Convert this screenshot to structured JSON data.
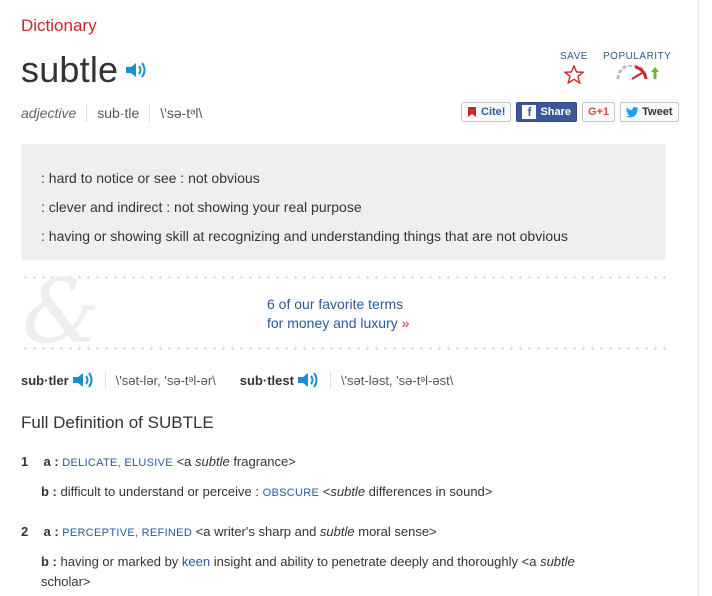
{
  "header": {
    "section_label": "Dictionary",
    "headword": "subtle",
    "part_of_speech": "adjective",
    "syllables": "sub·tle",
    "pronunciation": "\\'sə-tᵊl\\"
  },
  "actions": {
    "save_label": "SAVE",
    "popularity_label": "POPULARITY"
  },
  "share": {
    "cite": "Cite!",
    "facebook": "Share",
    "gplus": "G+1",
    "tweet": "Tweet"
  },
  "short_definitions": [
    ": hard to notice or see : not obvious",
    ": clever and indirect : not showing your real purpose",
    ": having or showing skill at recognizing and understanding things that are not obvious"
  ],
  "promo": {
    "line1": "6 of our favorite terms",
    "line2": "for money and luxury",
    "arrow": "»"
  },
  "inflections": [
    {
      "form": "sub·tler",
      "pron": "\\'sət-lər, 'sə-tᵊl-ər\\"
    },
    {
      "form": "sub·tlest",
      "pron": "\\'sət-ləst, 'sə-tᵊl-əst\\"
    }
  ],
  "full_definition": {
    "title": "Full Definition of SUBTLE",
    "senses": [
      {
        "num": "1",
        "a": {
          "letter": "a :",
          "syn": "DELICATE, ELUSIVE",
          "ex_pre": "<a ",
          "ex_word": "subtle",
          "ex_post": " fragrance>"
        },
        "b": {
          "letter": "b :",
          "text": "difficult to understand or perceive :",
          "syn": "OBSCURE",
          "ex_pre": " <",
          "ex_word": "subtle",
          "ex_post": " differences in sound>"
        }
      },
      {
        "num": "2",
        "a": {
          "letter": "a :",
          "syn": "PERCEPTIVE, REFINED",
          "ex_pre": " <a writer's sharp and ",
          "ex_word": "subtle",
          "ex_post": " moral sense>"
        },
        "b": {
          "letter": "b :",
          "text_pre": "having or marked by ",
          "keyword": "keen",
          "text_post": " insight and ability to penetrate deeply and thoroughly <a ",
          "ex_word": "subtle",
          "ex_line2": "scholar>"
        }
      }
    ]
  },
  "colors": {
    "accent_red": "#c8282a",
    "link_blue": "#2a5a9c",
    "facebook_blue": "#3b5998",
    "definition_bg": "#efefef"
  }
}
